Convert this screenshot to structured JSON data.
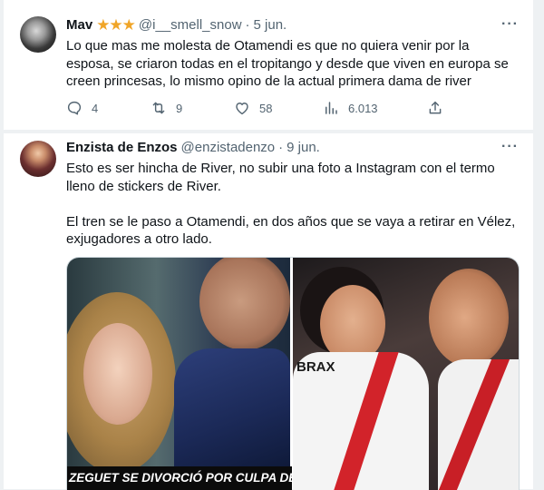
{
  "tweets": [
    {
      "name": "Mav",
      "stars": "★★★",
      "handle": "@i__smell_snow",
      "date": "5 jun.",
      "text": "Lo que mas me molesta de Otamendi es que no quiera venir por la esposa, se criaron todas en el tropitango y desde que viven en europa se creen princesas, lo mismo opino de la actual primera dama de river",
      "actions": {
        "replies": "4",
        "retweets": "9",
        "likes": "58",
        "views": "6.013"
      }
    },
    {
      "name": "Enzista de Enzos",
      "handle": "@enzistadenzo",
      "date": "9 jun.",
      "paragraphs": [
        "Esto es ser hincha de River, no subir una foto a Instagram con el termo lleno de stickers de River.",
        "El tren se le paso a Otamendi, en dos años que se vaya a retirar en Vélez, exjugadores a otro lado."
      ],
      "media": {
        "caption": "ZEGUET SE DIVORCIÓ POR CULPA DE RI",
        "jersey_text": "BRAX"
      }
    }
  ],
  "more_icon": "more-dots-icon"
}
